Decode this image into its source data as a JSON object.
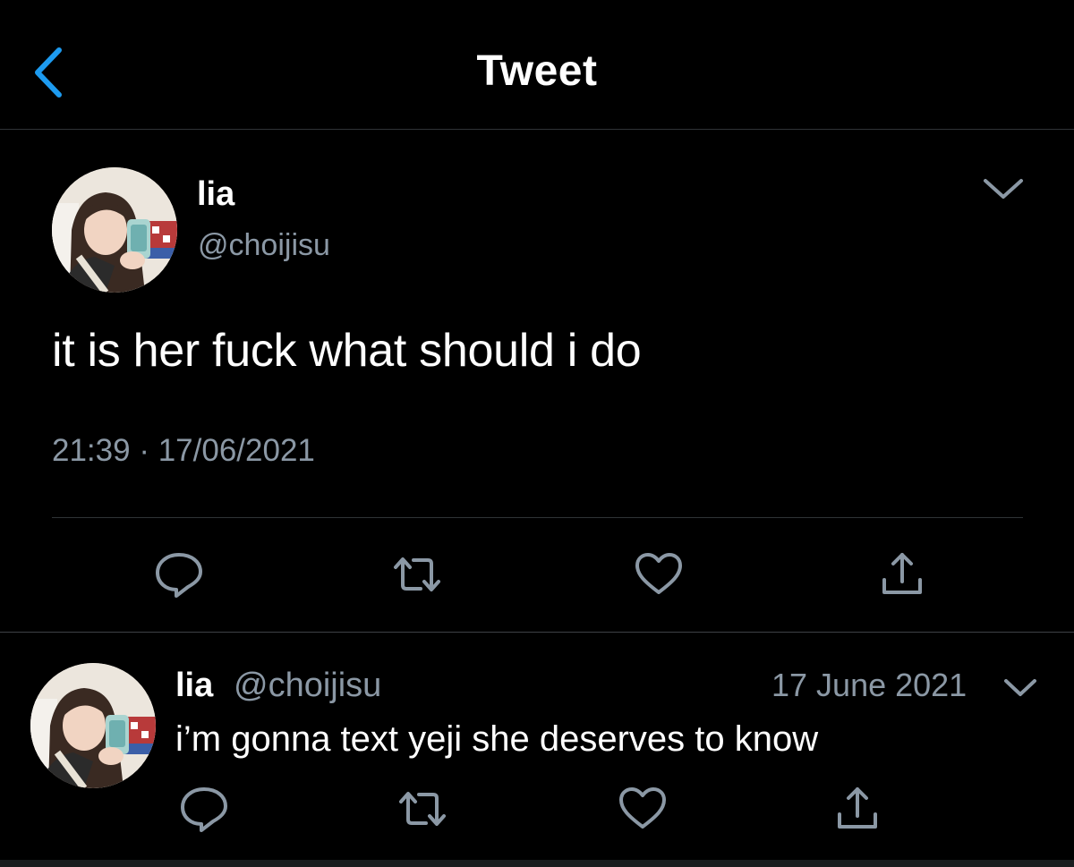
{
  "header": {
    "title": "Tweet",
    "back_icon": "chevron-left-icon",
    "accent_color": "#1d9bf0"
  },
  "tweet": {
    "author_name": "lia",
    "author_handle": "@choijisu",
    "text": "it is her fuck what should i do",
    "time": "21:39",
    "separator": "·",
    "date": "17/06/2021",
    "menu_icon": "chevron-down-icon",
    "actions": [
      "reply-icon",
      "retweet-icon",
      "like-icon",
      "share-icon"
    ]
  },
  "reply": {
    "author_name": "lia",
    "author_handle": "@choijisu",
    "date": "17 June 2021",
    "text": "i’m gonna text yeji she deserves to know",
    "menu_icon": "chevron-down-icon",
    "actions": [
      "reply-icon",
      "retweet-icon",
      "like-icon",
      "share-icon"
    ]
  },
  "colors": {
    "background": "#000000",
    "text": "#ffffff",
    "secondary_text": "#8b98a5",
    "divider": "#2f3336"
  }
}
